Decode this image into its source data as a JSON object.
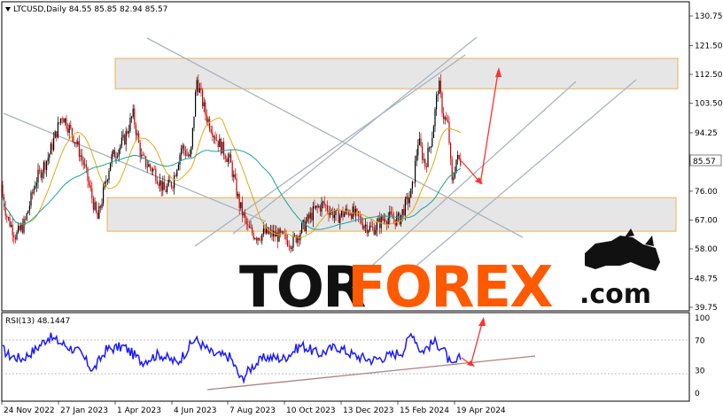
{
  "header": {
    "symbol_line": "LTCUSD,Daily  84.55 85.85 82.94 85.57"
  },
  "price_axis": {
    "ticks": [
      "130.75",
      "121.50",
      "112.50",
      "103.50",
      "94.25",
      "85.25",
      "76.00",
      "67.00",
      "58.00",
      "48.75",
      "39.75"
    ],
    "current_price_label": "85.57"
  },
  "rsi": {
    "label": "RSI(13) 48.1447",
    "ticks": [
      "100",
      "70",
      "30",
      "0"
    ]
  },
  "time_axis": {
    "labels": [
      "24 Nov 2022",
      "27 Jan 2023",
      "1 Apr 2023",
      "4 Jun 2023",
      "7 Aug 2023",
      "10 Oct 2023",
      "13 Dec 2023",
      "15 Feb 2024",
      "19 Apr 2024"
    ]
  },
  "logo": {
    "part1": "TOR",
    "part2": "FOREX",
    "part3": ".com"
  },
  "colors": {
    "candle_up": "#000000",
    "candle_down": "#cc0000",
    "ma_fast": "#e6a817",
    "ma_slow": "#19a39a",
    "rsi_line": "#1a1aff",
    "zone_fill": "#e6e6e6",
    "zone_border": "#f0b050",
    "trend_line": "#a8b4c0",
    "arrow": "#ff3030",
    "logo_dark": "#111111",
    "logo_orange": "#ff5a00"
  },
  "chart_data": {
    "type": "candlestick",
    "symbol": "LTCUSD",
    "timeframe": "Daily",
    "last_ohlc": {
      "open": 84.55,
      "high": 85.85,
      "low": 82.94,
      "close": 85.57
    },
    "price_range": [
      39.75,
      130.75
    ],
    "rsi_period": 13,
    "rsi_last": 48.1447,
    "rsi_range": [
      0,
      100
    ],
    "support_zone": [
      63.5,
      74.0
    ],
    "resistance_zone": [
      108.0,
      117.5
    ],
    "close_path": [
      [
        0,
        78
      ],
      [
        8,
        68
      ],
      [
        18,
        62
      ],
      [
        28,
        66
      ],
      [
        40,
        79
      ],
      [
        55,
        87
      ],
      [
        70,
        100
      ],
      [
        85,
        92
      ],
      [
        95,
        84
      ],
      [
        110,
        67
      ],
      [
        125,
        86
      ],
      [
        140,
        92
      ],
      [
        150,
        100
      ],
      [
        160,
        86
      ],
      [
        175,
        82
      ],
      [
        185,
        76
      ],
      [
        195,
        79
      ],
      [
        205,
        90
      ],
      [
        215,
        86
      ],
      [
        222,
        111
      ],
      [
        232,
        100
      ],
      [
        245,
        92
      ],
      [
        260,
        85
      ],
      [
        270,
        72
      ],
      [
        280,
        64
      ],
      [
        290,
        62
      ],
      [
        300,
        63
      ],
      [
        315,
        62
      ],
      [
        330,
        60
      ],
      [
        345,
        66
      ],
      [
        355,
        70
      ],
      [
        365,
        72
      ],
      [
        380,
        68
      ],
      [
        395,
        70
      ],
      [
        410,
        66
      ],
      [
        420,
        64
      ],
      [
        435,
        68
      ],
      [
        450,
        67
      ],
      [
        465,
        76
      ],
      [
        472,
        92
      ],
      [
        480,
        84
      ],
      [
        488,
        94
      ],
      [
        495,
        110
      ],
      [
        500,
        100
      ],
      [
        506,
        96
      ],
      [
        510,
        78
      ],
      [
        515,
        86
      ],
      [
        520,
        85.57
      ]
    ],
    "rsi_path": [
      [
        0,
        62
      ],
      [
        10,
        50
      ],
      [
        25,
        46
      ],
      [
        40,
        58
      ],
      [
        55,
        75
      ],
      [
        70,
        66
      ],
      [
        90,
        54
      ],
      [
        105,
        30
      ],
      [
        120,
        58
      ],
      [
        140,
        62
      ],
      [
        160,
        42
      ],
      [
        180,
        52
      ],
      [
        200,
        40
      ],
      [
        220,
        72
      ],
      [
        240,
        52
      ],
      [
        260,
        48
      ],
      [
        272,
        18
      ],
      [
        285,
        36
      ],
      [
        300,
        48
      ],
      [
        320,
        46
      ],
      [
        340,
        64
      ],
      [
        360,
        52
      ],
      [
        380,
        62
      ],
      [
        400,
        50
      ],
      [
        420,
        44
      ],
      [
        440,
        50
      ],
      [
        455,
        56
      ],
      [
        465,
        82
      ],
      [
        475,
        55
      ],
      [
        490,
        68
      ],
      [
        500,
        60
      ],
      [
        510,
        34
      ],
      [
        520,
        48
      ]
    ]
  }
}
